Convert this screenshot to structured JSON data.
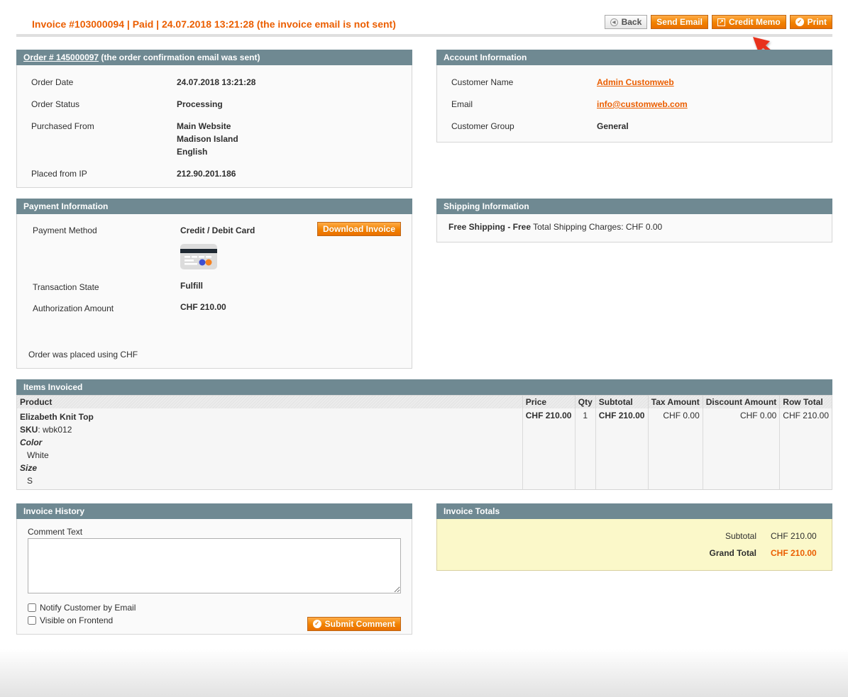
{
  "header": {
    "title": "Invoice #103000094 | Paid | 24.07.2018 13:21:28 (the invoice email is not sent)",
    "buttons": {
      "back": "Back",
      "send_email": "Send Email",
      "credit_memo": "Credit Memo",
      "print": "Print"
    }
  },
  "order": {
    "title_link": "Order # 145000097",
    "title_suffix": " (the order confirmation email was sent)",
    "rows": [
      {
        "label": "Order Date",
        "value": "24.07.2018 13:21:28"
      },
      {
        "label": "Order Status",
        "value": "Processing"
      },
      {
        "label": "Purchased From",
        "value_lines": [
          "Main Website",
          "Madison Island",
          "English"
        ]
      },
      {
        "label": "Placed from IP",
        "value": "212.90.201.186"
      }
    ]
  },
  "account": {
    "title": "Account Information",
    "rows": [
      {
        "label": "Customer Name",
        "value": "Admin Customweb"
      },
      {
        "label": "Email",
        "value": "info@customweb.com"
      },
      {
        "label": "Customer Group",
        "value": "General"
      }
    ]
  },
  "payment": {
    "title": "Payment Information",
    "download_button": "Download Invoice",
    "rows": [
      {
        "label": "Payment Method",
        "value": "Credit / Debit Card"
      },
      {
        "label": "Transaction State",
        "value": "Fulfill"
      },
      {
        "label": "Authorization Amount",
        "value": "CHF 210.00"
      }
    ],
    "footer_note": "Order was placed using CHF",
    "card_icon": "credit-card-icon"
  },
  "shipping": {
    "title": "Shipping Information",
    "method": "Free Shipping - Free",
    "charges": " Total Shipping Charges: CHF 0.00"
  },
  "items": {
    "title": "Items Invoiced",
    "columns": [
      "Product",
      "Price",
      "Qty",
      "Subtotal",
      "Tax Amount",
      "Discount Amount",
      "Row Total"
    ],
    "rows": [
      {
        "name": "Elizabeth Knit Top",
        "sku_label": "SKU",
        "sku": ": wbk012",
        "options": [
          {
            "label": "Color",
            "value": "White"
          },
          {
            "label": "Size",
            "value": "S"
          }
        ],
        "price": "CHF 210.00",
        "qty": "1",
        "subtotal": "CHF 210.00",
        "tax": "CHF 0.00",
        "discount": "CHF 0.00",
        "row_total": "CHF 210.00"
      }
    ]
  },
  "history": {
    "title": "Invoice History",
    "comment_label": "Comment Text",
    "comment_value": "",
    "notify_label": "Notify Customer by Email",
    "visible_label": "Visible on Frontend",
    "submit_label": "Submit Comment"
  },
  "totals": {
    "title": "Invoice Totals",
    "subtotal_label": "Subtotal",
    "subtotal_value": "CHF 210.00",
    "grand_label": "Grand Total",
    "grand_value": "CHF 210.00"
  },
  "colors": {
    "accent": "#eb5e00",
    "box_header": "#6f8992",
    "button_orange": "#f18200",
    "totals_bg": "#fbf8c9",
    "annotation_arrow": "#e8321c"
  }
}
